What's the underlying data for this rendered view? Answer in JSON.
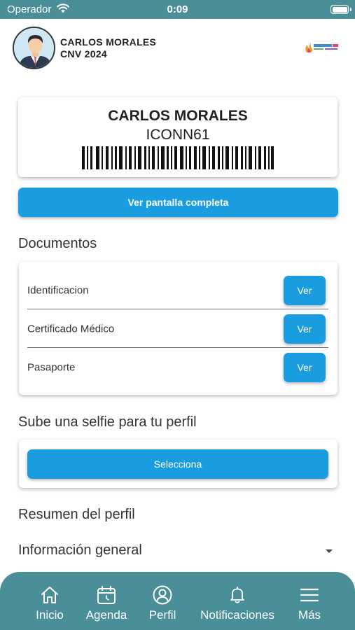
{
  "status_bar": {
    "carrier": "Operador",
    "time": "0:09"
  },
  "header": {
    "name": "CARLOS MORALES",
    "event": "CNV 2024",
    "logo_icon": "somos-logo"
  },
  "id_card": {
    "name": "CARLOS MORALES",
    "code": "ICONN61"
  },
  "full_screen_button": "Ver pantalla completa",
  "documents": {
    "title": "Documentos",
    "items": [
      {
        "label": "Identificacion",
        "button": "Ver"
      },
      {
        "label": "Certificado Médico",
        "button": "Ver"
      },
      {
        "label": "Pasaporte",
        "button": "Ver"
      }
    ]
  },
  "selfie": {
    "title": "Sube una selfie para tu perfil",
    "button": "Selecciona"
  },
  "summary": {
    "title": "Resumen del perfil"
  },
  "general": {
    "title": "Información general"
  },
  "bottom_nav": [
    {
      "label": "Inicio",
      "icon": "home-icon"
    },
    {
      "label": "Agenda",
      "icon": "calendar-icon"
    },
    {
      "label": "Perfil",
      "icon": "profile-icon"
    },
    {
      "label": "Notificaciones",
      "icon": "bell-icon"
    },
    {
      "label": "Más",
      "icon": "menu-icon"
    }
  ],
  "colors": {
    "primary": "#1a9de0",
    "header": "#4a8e98"
  }
}
